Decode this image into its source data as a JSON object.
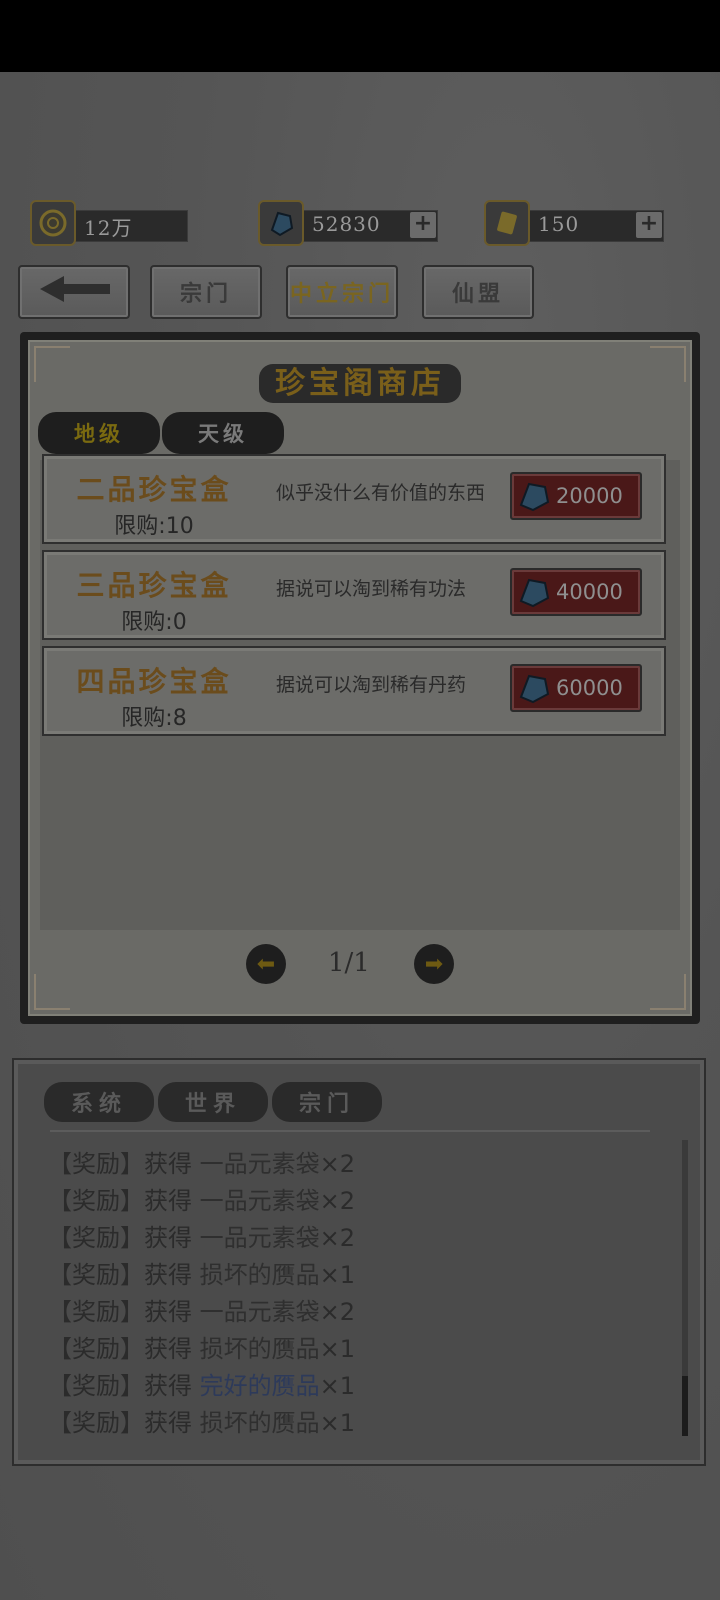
{
  "currency": {
    "coin": {
      "value": "12万"
    },
    "gem": {
      "value": "52830"
    },
    "scroll": {
      "value": "150"
    },
    "plus": "+"
  },
  "nav": {
    "back": "←",
    "sect": "宗门",
    "mid_sect": "中立宗门",
    "alliance": "仙盟"
  },
  "shop": {
    "title": "珍宝阁商店",
    "tabs": [
      "地级",
      "天级"
    ],
    "items": [
      {
        "name": "二品珍宝盒",
        "limit": "限购:10",
        "desc": "似乎没什么有价值的东西",
        "price": "20000"
      },
      {
        "name": "三品珍宝盒",
        "limit": "限购:0",
        "desc": "据说可以淘到稀有功法",
        "price": "40000"
      },
      {
        "name": "四品珍宝盒",
        "limit": "限购:8",
        "desc": "据说可以淘到稀有丹药",
        "price": "60000"
      }
    ],
    "page": "1/1",
    "prev": "⬅",
    "next": "➡"
  },
  "chat": {
    "tabs": [
      "系统",
      "世界",
      "宗门"
    ],
    "messages": [
      {
        "tag": "【奖励】获得 ",
        "item": "一品元素袋",
        "qty": "×2"
      },
      {
        "tag": "【奖励】获得 ",
        "item": "一品元素袋",
        "qty": "×2"
      },
      {
        "tag": "【奖励】获得 ",
        "item": "一品元素袋",
        "qty": "×2"
      },
      {
        "tag": "【奖励】获得 ",
        "item": "损坏的赝品",
        "qty": "×1"
      },
      {
        "tag": "【奖励】获得 ",
        "item": "一品元素袋",
        "qty": "×2"
      },
      {
        "tag": "【奖励】获得 ",
        "item": "损坏的赝品",
        "qty": "×1"
      },
      {
        "tag": "【奖励】获得 ",
        "item": "完好的赝品",
        "qty": "×1"
      },
      {
        "tag": "【奖励】获得 ",
        "item": "损坏的赝品",
        "qty": "×1"
      }
    ]
  },
  "colors": {
    "accent_gold": "#7a5f1a",
    "buy_button": "#4a1818",
    "rare_item": "#2d3a5a"
  },
  "icons": {
    "coin": "coin-icon",
    "gem": "gem-icon",
    "scroll": "scroll-icon",
    "back": "back-arrow-icon",
    "prev": "prev-page-icon",
    "next": "next-page-icon"
  }
}
